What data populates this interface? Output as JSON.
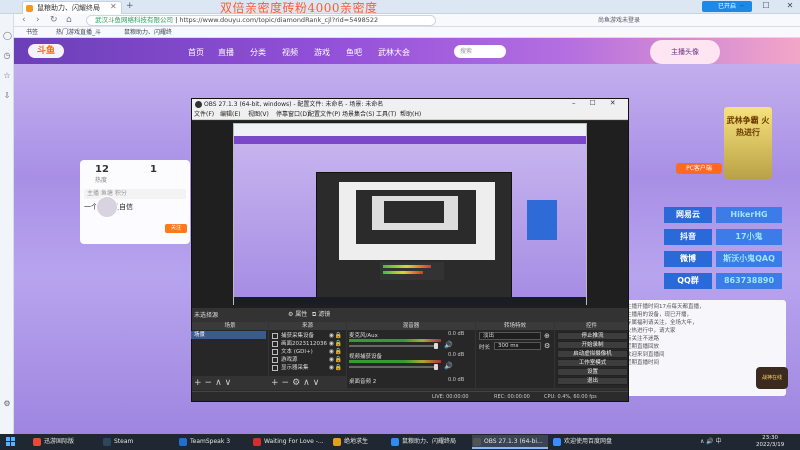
{
  "browser": {
    "tab_title": "鼠粮助力、闪耀终局",
    "overlay_banner": "双倍亲密度砖粉4000亲密度",
    "cloud_badge": "已开启",
    "omnibox_site": "武汉斗鱼网络科技有限公司",
    "omnibox_url": "https://www.douyu.com/topic/diamondRank_cjl?rid=5498522",
    "login_text": "尚鱼游戏未登录",
    "bookmarks": [
      "书签",
      "热门游戏直播_斗",
      "鼠粮助力、闪耀终"
    ],
    "window_controls": [
      "–",
      "☐",
      "✕"
    ]
  },
  "douyu": {
    "logo": "斗鱼",
    "nav_items": [
      "首页",
      "直播",
      "分类",
      "视频",
      "游戏",
      "鱼吧",
      "武林大会"
    ],
    "search_placeholder": "搜索",
    "anchor_label": "主播头像",
    "stat_count": "12",
    "stat_label": "热度",
    "viewer_count": "1",
    "card_tabs": "主播  鱼塘  积分",
    "card_text": "一个普通又自信",
    "card_button": "关注",
    "pc_client": "PC客户端",
    "right_ad": "武林争霸 火热进行",
    "social": [
      {
        "name": "网易云",
        "value": "HikerHG"
      },
      {
        "name": "抖音",
        "value": "17小鬼"
      },
      {
        "name": "微博",
        "value": "斯沃小鬼QAQ"
      },
      {
        "name": "QQ群",
        "value": "863738890"
      }
    ],
    "desc_lines": [
      "主播开播时间17点每天都直播，",
      "主播用的设备，现已开播，",
      "专属福利请关注，全场大年，",
      "火热进行中，请大家",
      "点关注不迷路",
      "",
      "近期直播回放",
      "欢迎来到直播间",
      "近期直播时间"
    ],
    "fan_badge": "战神在线"
  },
  "obs": {
    "title": "OBS 27.1.3 (64-bit, windows) - 配置文件: 未命名 - 场景: 未命名",
    "menu": [
      "文件(F)",
      "编辑(E)",
      "视图(V)",
      "停靠窗口(D)",
      "配置文件(P)",
      "场景集合(S)",
      "工具(T)",
      "帮助(H)"
    ],
    "no_source": "未选择源",
    "properties": "⚙ 属性",
    "filters": "⧉ 滤镜",
    "docks": {
      "scenes": "场景",
      "sources": "来源",
      "mixer": "混音器",
      "transitions": "转场特效",
      "controls": "控件"
    },
    "scene_item": "场景",
    "sources": [
      "捕获采集设备",
      "画面2023112036",
      "文本 (GDI+)",
      "游戏源",
      "显示器采集"
    ],
    "mixer": [
      {
        "name": "麦克风/Aux",
        "db": "0.0 dB"
      },
      {
        "name": "视频捕获设备",
        "db": "0.0 dB"
      },
      {
        "name": "桌面音频 2",
        "db": "0.0 dB"
      }
    ],
    "transition_select": "淡出",
    "duration_label": "时长",
    "duration_value": "300 ms",
    "controls": [
      "停止推流",
      "开始录制",
      "启动虚拟摄像机",
      "工作室模式",
      "设置",
      "退出"
    ],
    "status": {
      "live": "LIVE: 00:00:00",
      "rec": "REC: 00:00:00",
      "cpu": "CPU: 0.4%, 60.00 fps"
    }
  },
  "taskbar": {
    "apps": [
      {
        "label": "迅游国际版",
        "color": "#e84a3a"
      },
      {
        "label": "Steam",
        "color": "#2a475e"
      },
      {
        "label": "TeamSpeak 3",
        "color": "#1f6fd0"
      },
      {
        "label": "Waiting For Love -...",
        "color": "#d32f2f"
      },
      {
        "label": "绝地求生",
        "color": "#e0a11b"
      },
      {
        "label": "鼠粮助力、闪耀终局",
        "color": "#2f8cf0"
      },
      {
        "label": "OBS 27.1.3 (64-bi...",
        "color": "#555555"
      },
      {
        "label": "欢迎使用百度网盘",
        "color": "#3c8dff"
      }
    ],
    "tray": "∧ 🔊 中",
    "time": "23:30",
    "date": "2022/3/19"
  }
}
